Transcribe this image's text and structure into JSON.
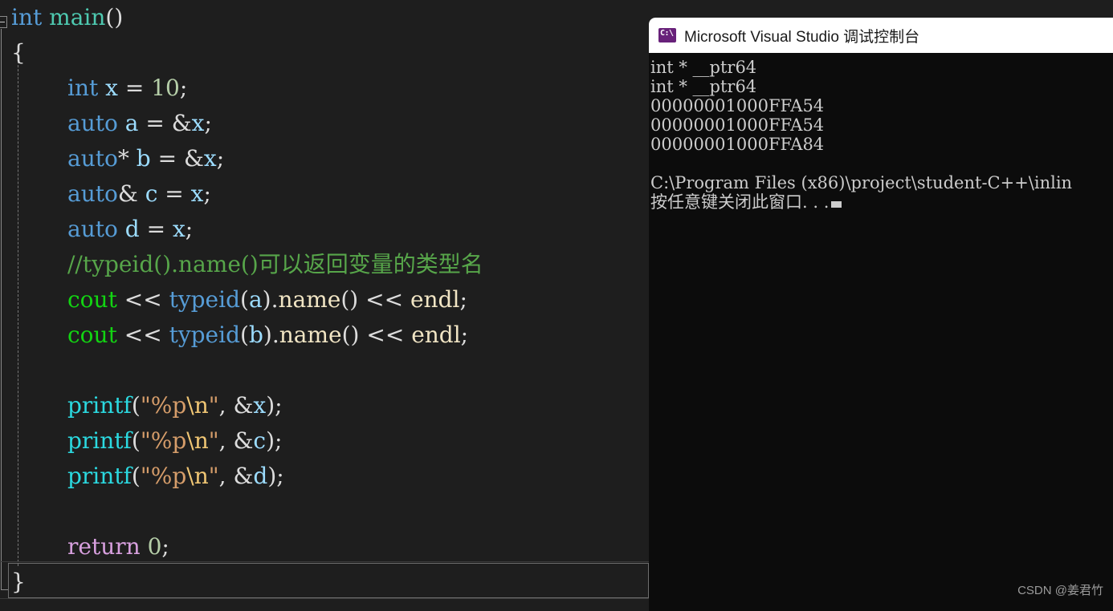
{
  "editor": {
    "name": "visual-studio-code-editor",
    "background": "#1e1e1e",
    "outlining": {
      "collapse_glyph": "collapse-minus-icon"
    },
    "code_lines": [
      {
        "indent": 0,
        "tokens": [
          {
            "t": "int",
            "c": "kw"
          },
          {
            "t": " ",
            "c": "plain"
          },
          {
            "t": "main",
            "c": "fn-main"
          },
          {
            "t": "()",
            "c": "plain"
          }
        ]
      },
      {
        "indent": 0,
        "tokens": [
          {
            "t": "{",
            "c": "brace"
          }
        ]
      },
      {
        "indent": 2,
        "tokens": [
          {
            "t": "int",
            "c": "kw"
          },
          {
            "t": " ",
            "c": "plain"
          },
          {
            "t": "x",
            "c": "var"
          },
          {
            "t": " = ",
            "c": "plain"
          },
          {
            "t": "10",
            "c": "num"
          },
          {
            "t": ";",
            "c": "plain"
          }
        ]
      },
      {
        "indent": 2,
        "tokens": [
          {
            "t": "auto",
            "c": "kw"
          },
          {
            "t": " ",
            "c": "plain"
          },
          {
            "t": "a",
            "c": "var"
          },
          {
            "t": " = ",
            "c": "plain"
          },
          {
            "t": "&",
            "c": "amp"
          },
          {
            "t": "x",
            "c": "var"
          },
          {
            "t": ";",
            "c": "plain"
          }
        ]
      },
      {
        "indent": 2,
        "tokens": [
          {
            "t": "auto",
            "c": "kw"
          },
          {
            "t": "*",
            "c": "plain"
          },
          {
            "t": " ",
            "c": "plain"
          },
          {
            "t": "b",
            "c": "var"
          },
          {
            "t": " = ",
            "c": "plain"
          },
          {
            "t": "&",
            "c": "amp"
          },
          {
            "t": "x",
            "c": "var"
          },
          {
            "t": ";",
            "c": "plain"
          }
        ]
      },
      {
        "indent": 2,
        "tokens": [
          {
            "t": "auto",
            "c": "kw"
          },
          {
            "t": "&",
            "c": "plain"
          },
          {
            "t": " ",
            "c": "plain"
          },
          {
            "t": "c",
            "c": "var"
          },
          {
            "t": " = ",
            "c": "plain"
          },
          {
            "t": "x",
            "c": "var"
          },
          {
            "t": ";",
            "c": "plain"
          }
        ]
      },
      {
        "indent": 2,
        "tokens": [
          {
            "t": "auto",
            "c": "kw"
          },
          {
            "t": " ",
            "c": "plain"
          },
          {
            "t": "d",
            "c": "var"
          },
          {
            "t": " = ",
            "c": "plain"
          },
          {
            "t": "x",
            "c": "var"
          },
          {
            "t": ";",
            "c": "plain"
          }
        ]
      },
      {
        "indent": 2,
        "tokens": [
          {
            "t": "//typeid().name()可以返回变量的类型名",
            "c": "comment"
          }
        ]
      },
      {
        "indent": 2,
        "tokens": [
          {
            "t": "cout",
            "c": "cout"
          },
          {
            "t": " << ",
            "c": "plain"
          },
          {
            "t": "typeid",
            "c": "typeid"
          },
          {
            "t": "(",
            "c": "plain"
          },
          {
            "t": "a",
            "c": "var"
          },
          {
            "t": ")",
            "c": "plain"
          },
          {
            "t": ".",
            "c": "plain"
          },
          {
            "t": "name",
            "c": "member"
          },
          {
            "t": "()",
            "c": "plain"
          },
          {
            "t": " << ",
            "c": "plain"
          },
          {
            "t": "endl",
            "c": "member"
          },
          {
            "t": ";",
            "c": "plain"
          }
        ]
      },
      {
        "indent": 2,
        "tokens": [
          {
            "t": "cout",
            "c": "cout"
          },
          {
            "t": " << ",
            "c": "plain"
          },
          {
            "t": "typeid",
            "c": "typeid"
          },
          {
            "t": "(",
            "c": "plain"
          },
          {
            "t": "b",
            "c": "var"
          },
          {
            "t": ")",
            "c": "plain"
          },
          {
            "t": ".",
            "c": "plain"
          },
          {
            "t": "name",
            "c": "member"
          },
          {
            "t": "()",
            "c": "plain"
          },
          {
            "t": " << ",
            "c": "plain"
          },
          {
            "t": "endl",
            "c": "member"
          },
          {
            "t": ";",
            "c": "plain"
          }
        ]
      },
      {
        "indent": 2,
        "tokens": [
          {
            "t": "",
            "c": "plain"
          }
        ]
      },
      {
        "indent": 2,
        "tokens": [
          {
            "t": "printf",
            "c": "printf"
          },
          {
            "t": "(",
            "c": "plain"
          },
          {
            "t": "\"%p",
            "c": "str"
          },
          {
            "t": "\\n",
            "c": "esc"
          },
          {
            "t": "\"",
            "c": "str"
          },
          {
            "t": ", ",
            "c": "plain"
          },
          {
            "t": "&",
            "c": "amp"
          },
          {
            "t": "x",
            "c": "var"
          },
          {
            "t": ");",
            "c": "plain"
          }
        ]
      },
      {
        "indent": 2,
        "tokens": [
          {
            "t": "printf",
            "c": "printf"
          },
          {
            "t": "(",
            "c": "plain"
          },
          {
            "t": "\"%p",
            "c": "str"
          },
          {
            "t": "\\n",
            "c": "esc"
          },
          {
            "t": "\"",
            "c": "str"
          },
          {
            "t": ", ",
            "c": "plain"
          },
          {
            "t": "&",
            "c": "amp"
          },
          {
            "t": "c",
            "c": "var"
          },
          {
            "t": ");",
            "c": "plain"
          }
        ]
      },
      {
        "indent": 2,
        "tokens": [
          {
            "t": "printf",
            "c": "printf"
          },
          {
            "t": "(",
            "c": "plain"
          },
          {
            "t": "\"%p",
            "c": "str"
          },
          {
            "t": "\\n",
            "c": "esc"
          },
          {
            "t": "\"",
            "c": "str"
          },
          {
            "t": ", ",
            "c": "plain"
          },
          {
            "t": "&",
            "c": "amp"
          },
          {
            "t": "d",
            "c": "var"
          },
          {
            "t": ");",
            "c": "plain"
          }
        ]
      },
      {
        "indent": 2,
        "tokens": [
          {
            "t": "",
            "c": "plain"
          }
        ]
      },
      {
        "indent": 2,
        "tokens": [
          {
            "t": "return",
            "c": "kw-ctl"
          },
          {
            "t": " ",
            "c": "plain"
          },
          {
            "t": "0",
            "c": "num"
          },
          {
            "t": ";",
            "c": "plain"
          }
        ]
      },
      {
        "indent": 0,
        "tokens": [
          {
            "t": "}",
            "c": "brace"
          }
        ]
      }
    ]
  },
  "console": {
    "title": "Microsoft Visual Studio 调试控制台",
    "icon": "cmd-prompt-icon",
    "background": "#0c0c0c",
    "titlebar_background": "#ffffff",
    "output_lines": [
      "int * __ptr64",
      "int * __ptr64",
      "00000001000FFA54",
      "00000001000FFA54",
      "00000001000FFA84",
      "",
      "C:\\Program Files (x86)\\project\\student-C++\\inlin"
    ],
    "prompt_line": "按任意键关闭此窗口. . ."
  },
  "watermark": {
    "text": "CSDN @姜君竹"
  }
}
